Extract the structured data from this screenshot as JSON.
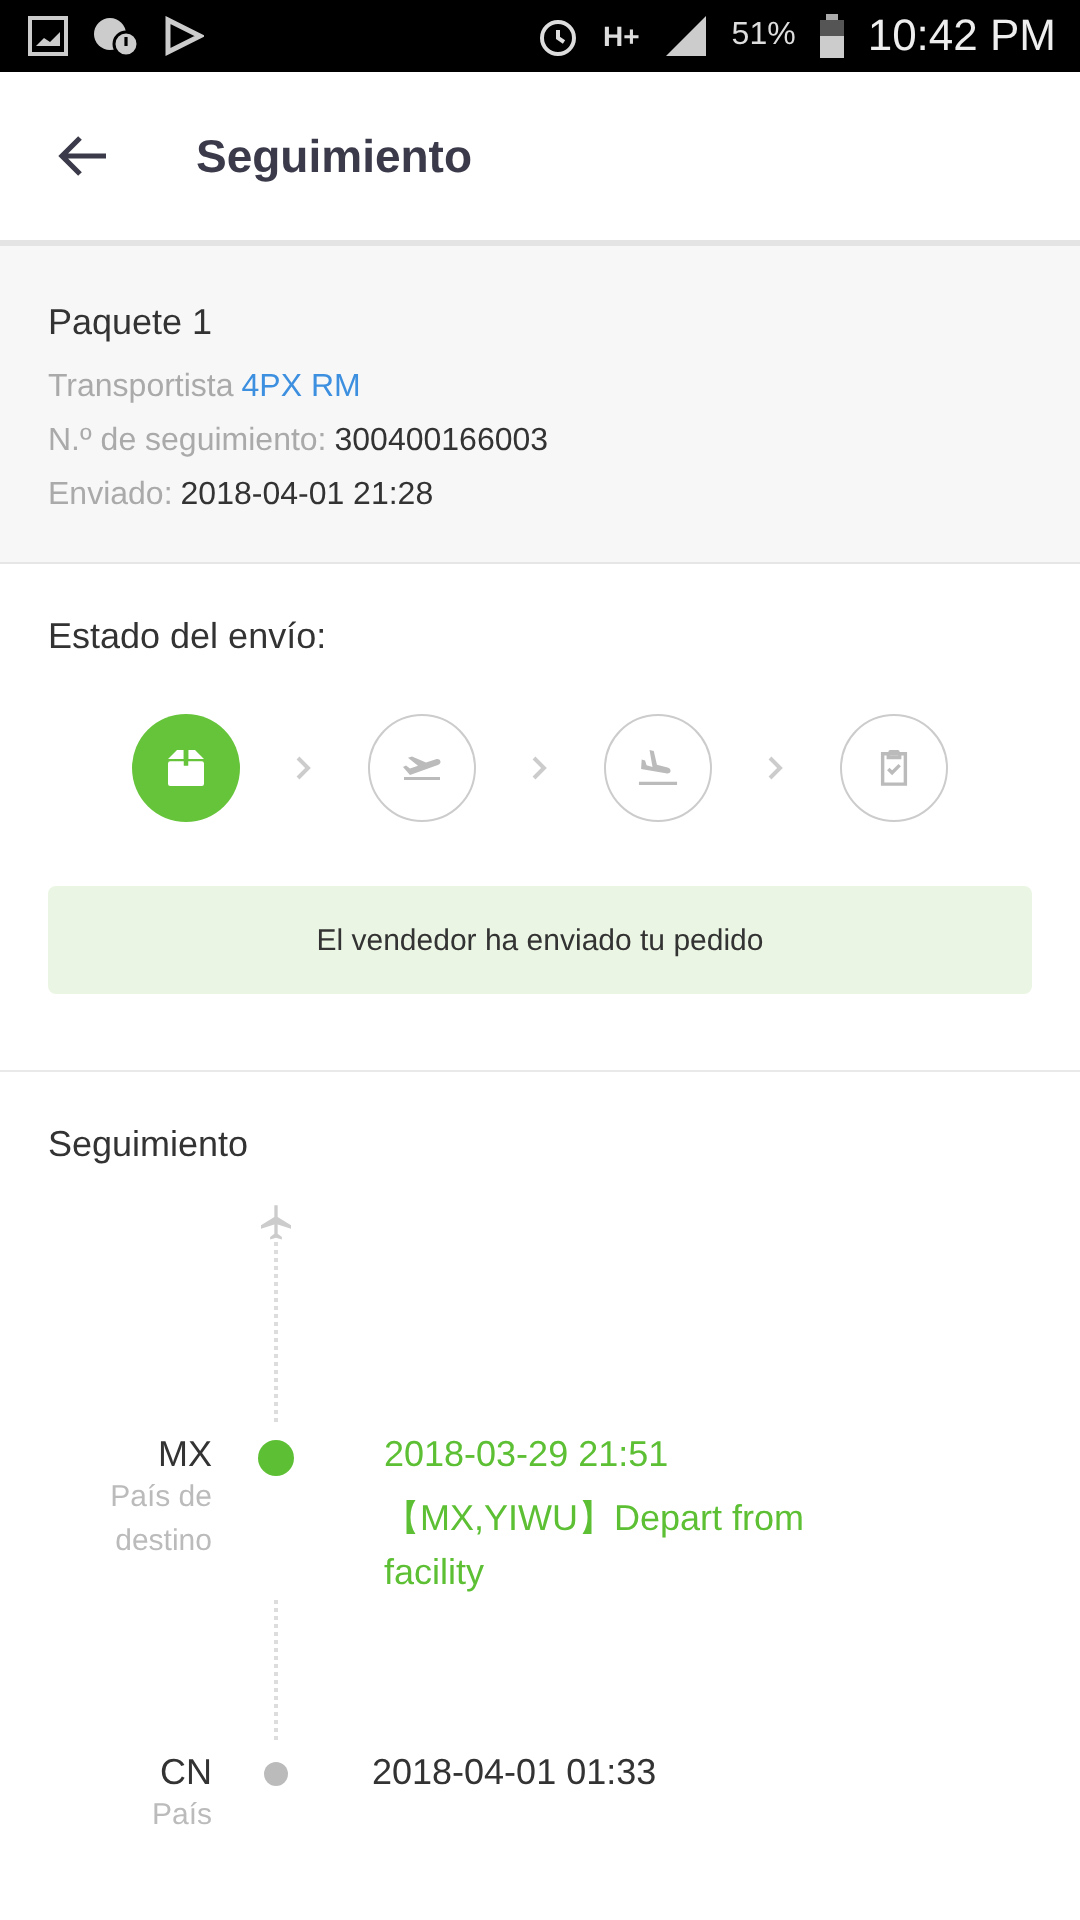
{
  "status_bar": {
    "network": "H+",
    "battery": "51%",
    "time": "10:42 PM"
  },
  "header": {
    "title": "Seguimiento"
  },
  "package": {
    "title": "Paquete 1",
    "carrier_label": "Transportista",
    "carrier": "4PX RM",
    "tracking_label": "N.º de seguimiento:",
    "tracking_number": "300400166003",
    "sent_label": "Enviado:",
    "sent_date": "2018-04-01 21:28"
  },
  "shipment_status": {
    "title": "Estado del envío:",
    "steps": [
      {
        "kind": "package",
        "selected": true
      },
      {
        "kind": "takeoff",
        "selected": false
      },
      {
        "kind": "landing",
        "selected": false
      },
      {
        "kind": "delivered",
        "selected": false
      }
    ],
    "message": "El vendedor ha enviado tu pedido"
  },
  "tracking": {
    "title": "Seguimiento",
    "events": [
      {
        "country": "MX",
        "country_note": "País de destino",
        "time": "2018-03-29 21:51",
        "description": "【MX,YIWU】Depart from facility",
        "selected": true
      },
      {
        "country": "CN",
        "country_note": "País",
        "time": "2018-04-01 01:33",
        "selected": false
      }
    ]
  }
}
